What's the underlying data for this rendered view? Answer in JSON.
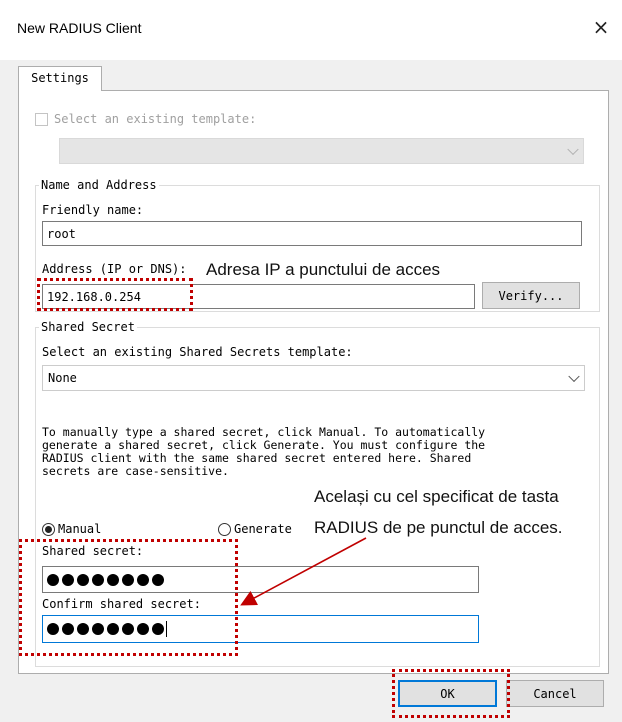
{
  "window": {
    "title": "New RADIUS Client",
    "close_icon": "×"
  },
  "tabs": [
    {
      "label": "Settings"
    }
  ],
  "template": {
    "checkbox_label": "Select an existing template:",
    "selected": ""
  },
  "name_address": {
    "group_title": "Name and Address",
    "friendly_label": "Friendly name:",
    "friendly_value": "root",
    "address_label": "Address (IP or DNS):",
    "address_value": "192.168.0.254",
    "verify_label": "Verify..."
  },
  "shared_secret": {
    "group_title": "Shared Secret",
    "template_label": "Select an existing Shared Secrets template:",
    "template_value": "None",
    "info_text": "To manually type a shared secret, click Manual. To automatically\ngenerate a shared secret, click Generate. You must configure the\nRADIUS client with the same shared secret entered here. Shared\nsecrets are case-sensitive.",
    "manual_label": "Manual",
    "generate_label": "Generate",
    "manual_selected": true,
    "secret_label": "Shared secret:",
    "secret_dots": 8,
    "confirm_label": "Confirm shared secret:",
    "confirm_dots": 8
  },
  "buttons": {
    "ok_label": "OK",
    "cancel_label": "Cancel"
  },
  "annotations": {
    "address_note": "Adresa IP a punctului de acces",
    "secret_note_line1": "Același cu cel specificat de tasta",
    "secret_note_line2": "RADIUS de pe punctul de acces."
  },
  "colors": {
    "highlight": "#c00000",
    "focus": "#0078d7"
  }
}
